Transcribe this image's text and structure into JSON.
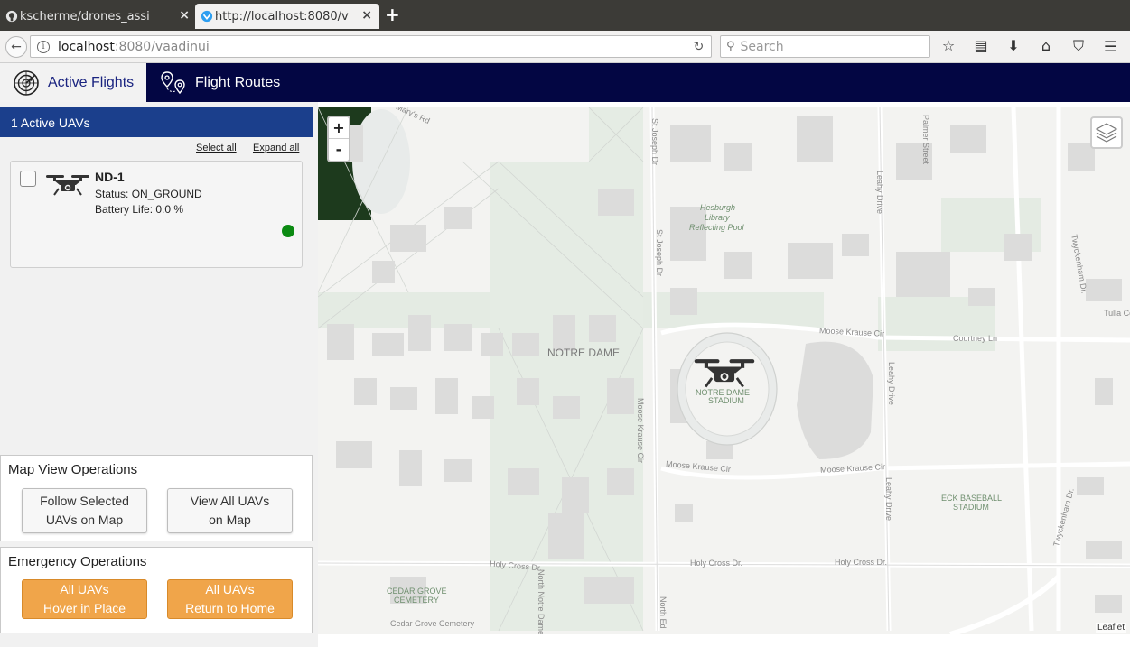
{
  "browser": {
    "tabs": [
      {
        "title": "kscherme/drones_assi",
        "active": false
      },
      {
        "title": "http://localhost:8080/v",
        "active": true
      }
    ],
    "url_host": "localhost",
    "url_rest": ":8080/vaadinui",
    "search_placeholder": "Search"
  },
  "app": {
    "nav": [
      {
        "label": "Active Flights",
        "icon": "radar-icon",
        "active": true
      },
      {
        "label": "Flight Routes",
        "icon": "route-pins-icon",
        "active": false
      }
    ]
  },
  "uav_panel": {
    "header": "1 Active UAVs",
    "select_all": "Select all",
    "expand_all": "Expand all",
    "uavs": [
      {
        "name": "ND-1",
        "status": "Status: ON_GROUND",
        "battery": "Battery Life: 0.0 %",
        "indicator_color": "#0b8a12"
      }
    ]
  },
  "map_ops": {
    "title": "Map View Operations",
    "follow_line1": "Follow Selected",
    "follow_line2": "UAVs on Map",
    "viewall_line1": "View All UAVs",
    "viewall_line2": "on Map"
  },
  "emergency_ops": {
    "title": "Emergency Operations",
    "hover_line1": "All UAVs",
    "hover_line2": "Hover in Place",
    "rth_line1": "All UAVs",
    "rth_line2": "Return to Home"
  },
  "map": {
    "zoom_in": "+",
    "zoom_out": "-",
    "attribution": "Leaflet",
    "labels": {
      "notre_dame": "NOTRE DAME",
      "stadium_1": "NOTRE DAME",
      "stadium_2": "STADIUM",
      "hesburgh_1": "Hesburgh",
      "hesburgh_2": "Library",
      "hesburgh_3": "Reflecting Pool",
      "baseball_1": "ECK BASEBALL",
      "baseball_2": "STADIUM",
      "cedar_1": "CEDAR GROVE",
      "cedar_2": "CEMETERY",
      "cedar_road": "Cedar Grove Cemetery",
      "moose_krause_1": "Moose Krause Cir",
      "moose_krause_2": "Moose Krause Cir",
      "moose_krause_3": "Moose Krause Cir",
      "courtney": "Courtney Ln",
      "holy_cross_1": "Holy Cross Dr.",
      "holy_cross_2": "Holy Cross Dr.",
      "holy_cross_3": "Holy Cross Dr.",
      "twyckenham_1": "Twyckenham Dr.",
      "twyckenham_2": "Twyckenham Dr.",
      "leahy_1": "Leahy Drive",
      "leahy_2": "Leahy Drive",
      "leahy_3": "Leahy Drive",
      "st_joseph_1": "St Joseph Dr",
      "st_joseph_2": "St Joseph Dr",
      "palmer": "Palmer Street",
      "tulla": "Tulla Court",
      "marys": "Mary's Rd",
      "north_notre_dame": "North Notre Dame",
      "north_ed": "North Ed",
      "moose_krause_cir": "Moose Krause Cir"
    }
  }
}
